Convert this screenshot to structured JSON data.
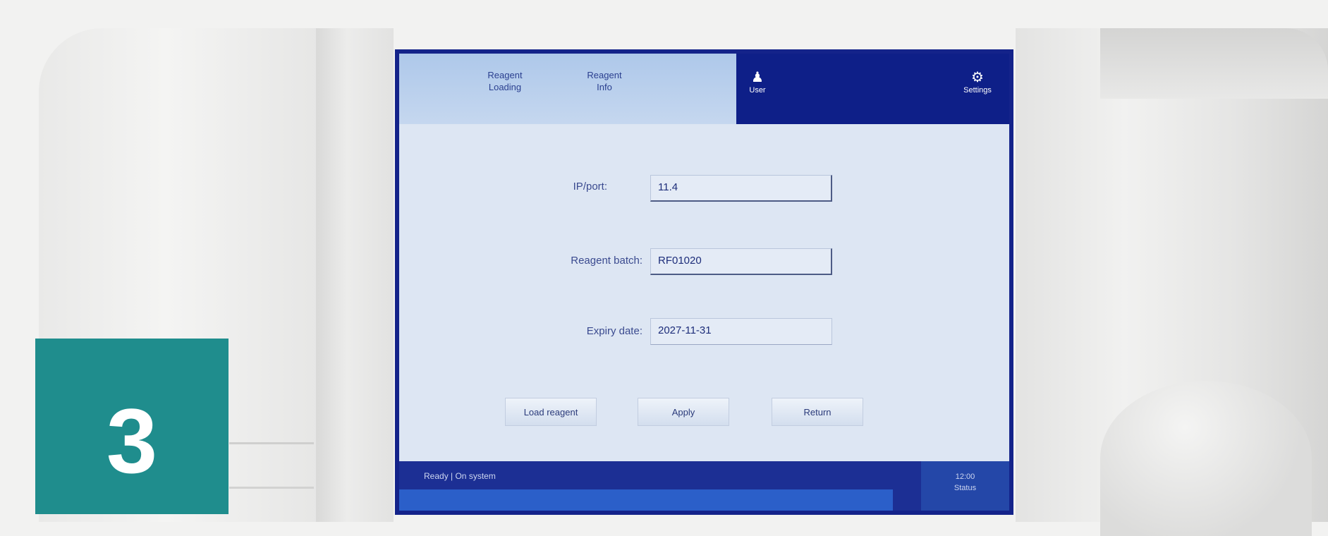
{
  "step_badge": {
    "number": "3"
  },
  "screen": {
    "tabs": [
      {
        "label": "Reagent\nLoading"
      },
      {
        "label": "Reagent\nInfo"
      }
    ],
    "user_label": "User",
    "settings_label": "Settings",
    "form": {
      "ip_label": "IP/port:",
      "ip_value": "11.4",
      "reagent_batch_label": "Reagent batch:",
      "reagent_batch_value": "RF01020",
      "expiry_date_label": "Expiry date:",
      "expiry_date_value": "2027-11-31"
    },
    "buttons": {
      "b1": "Load reagent",
      "b2": "Apply",
      "b3": "Return"
    },
    "status": {
      "text": "Ready | On system",
      "side": "12:00\nStatus"
    }
  }
}
